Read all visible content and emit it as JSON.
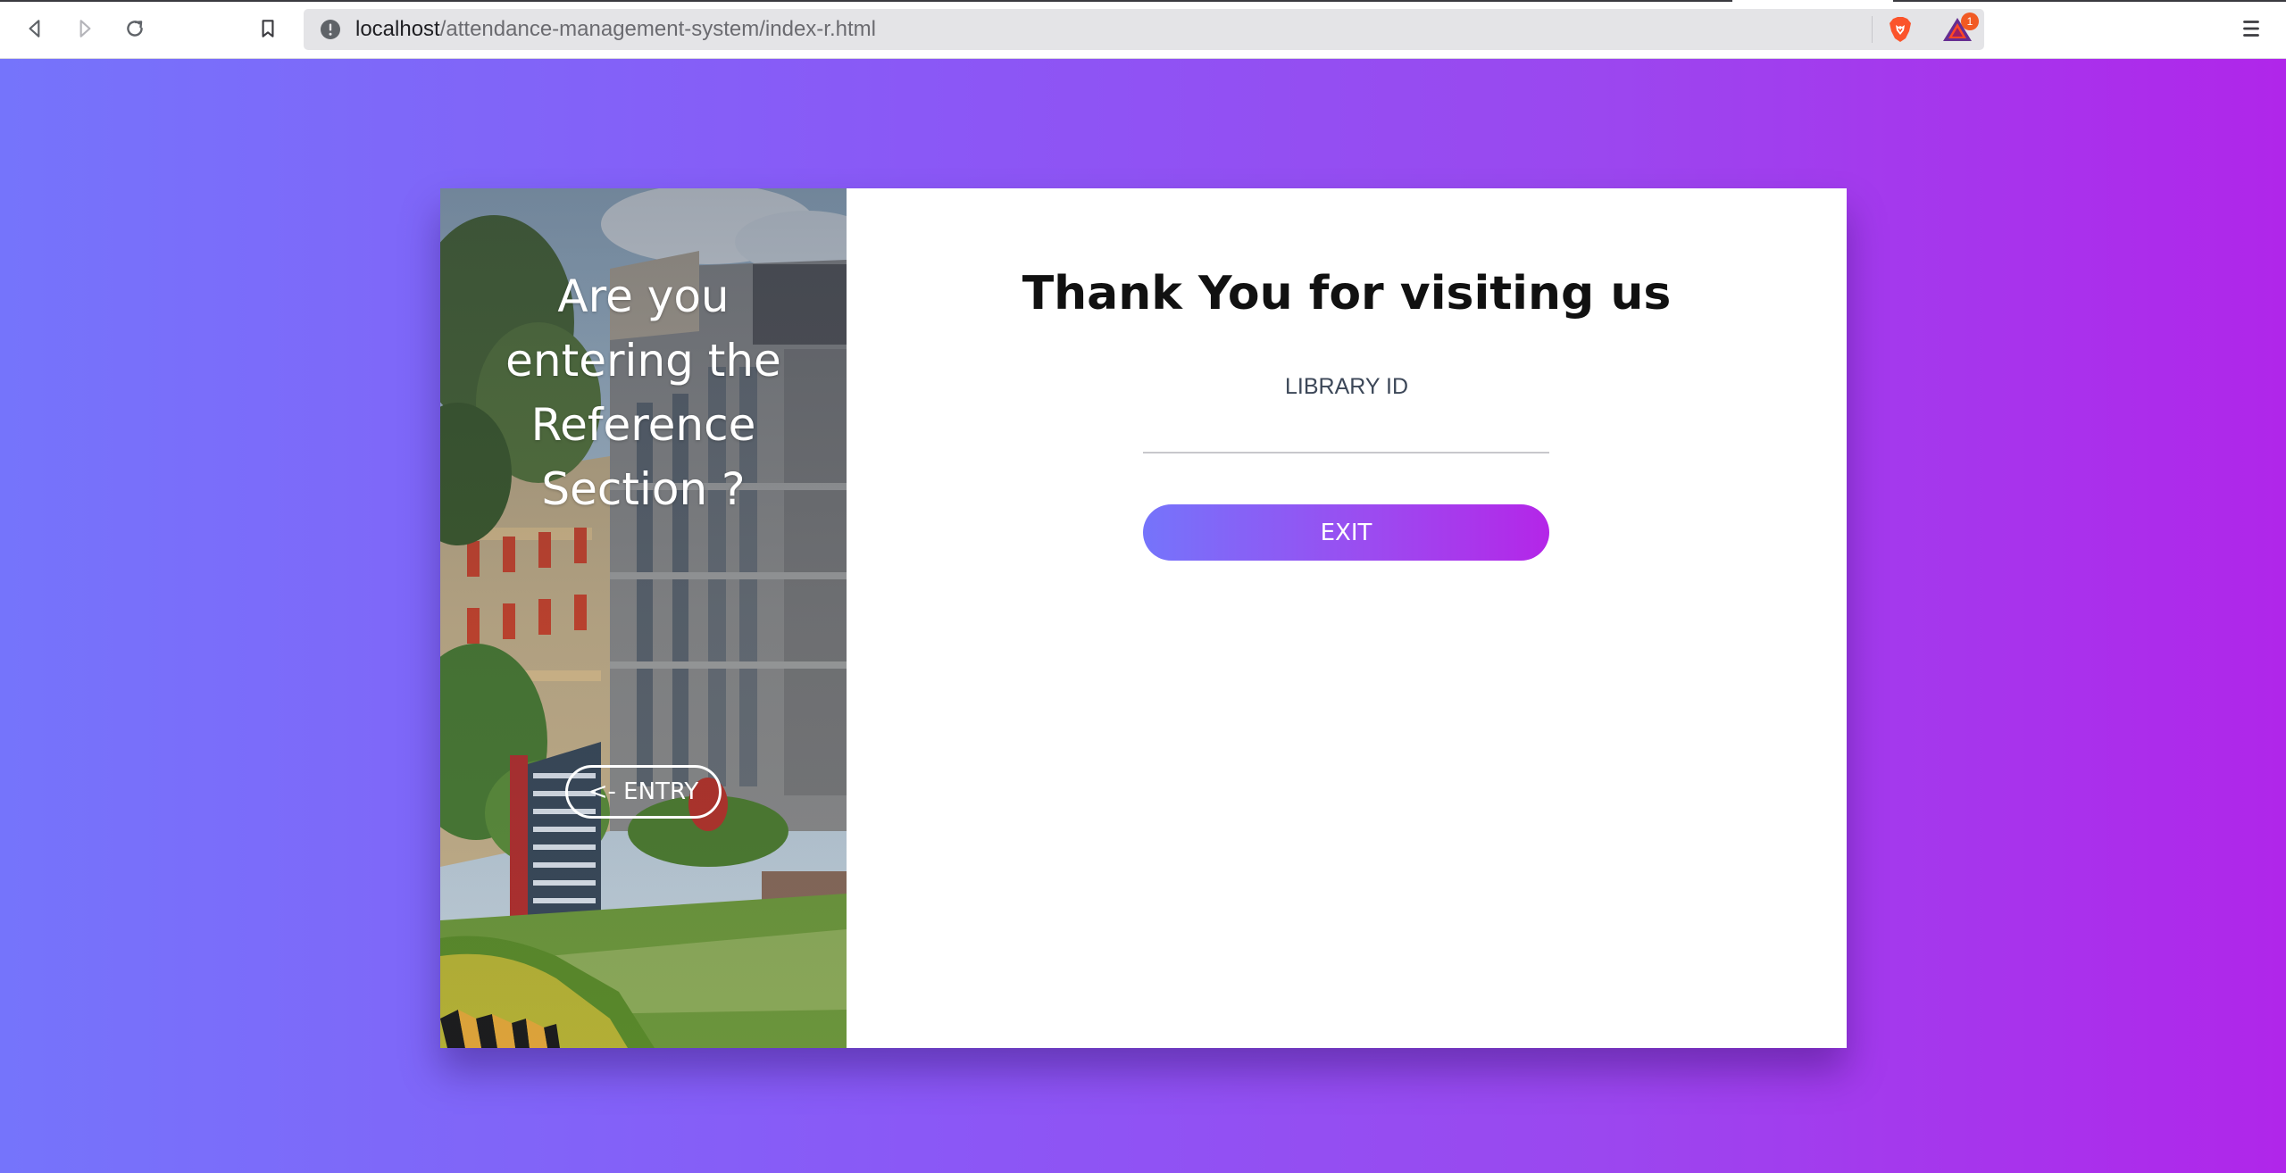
{
  "browser": {
    "url_host": "localhost",
    "url_path": "/attendance-management-system/index-r.html",
    "rewards_badge_count": "1",
    "icons": {
      "back": "back-arrow-icon",
      "forward": "forward-arrow-icon",
      "reload": "reload-icon",
      "bookmark": "bookmark-icon",
      "site_info": "info-icon",
      "brave_shields": "brave-lion-icon",
      "rewards": "brave-rewards-triangle-icon",
      "menu": "hamburger-menu-icon"
    }
  },
  "colors": {
    "gradient_start": "#7574fb",
    "gradient_end": "#b026ea",
    "card_background": "#ffffff"
  },
  "side_panel": {
    "question": "Are you entering the Reference Section ?",
    "entry_button_label": "<- ENTRY"
  },
  "form": {
    "title": "Thank You for visiting us",
    "library_id_label": "LIBRARY ID",
    "library_id_value": "",
    "exit_button_label": "EXIT"
  }
}
